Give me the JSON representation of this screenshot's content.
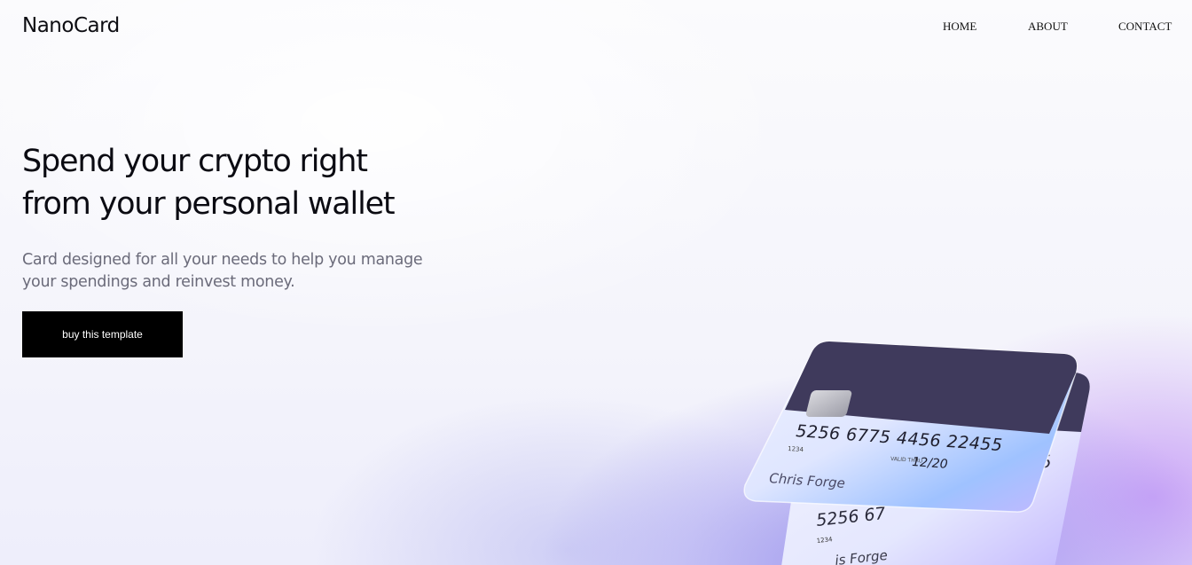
{
  "header": {
    "logo": "NanoCard",
    "nav": [
      {
        "label": "HOME"
      },
      {
        "label": "ABOUT"
      },
      {
        "label": "CONTACT"
      }
    ]
  },
  "hero": {
    "title_line1": "Spend your crypto right",
    "title_line2": "from your personal wallet",
    "subtitle_line1": "Card designed for all your needs to help you manage",
    "subtitle_line2": "your spendings and reinvest money.",
    "cta_label": "buy this template"
  },
  "cards": {
    "front": {
      "number": "5256 6775 4456  22455",
      "small_code": "1234",
      "valid_label": "VALID THRU",
      "expiry": "12/20",
      "holder": "Chris Forge"
    },
    "back": {
      "number_partial": "5256 67",
      "number_tail": "455",
      "small_code": "1234",
      "holder_partial": "is Forge"
    }
  },
  "colors": {
    "accent_purple": "#7b6cf0",
    "card_stripe": "#3f3a5c",
    "button_bg": "#000000"
  }
}
